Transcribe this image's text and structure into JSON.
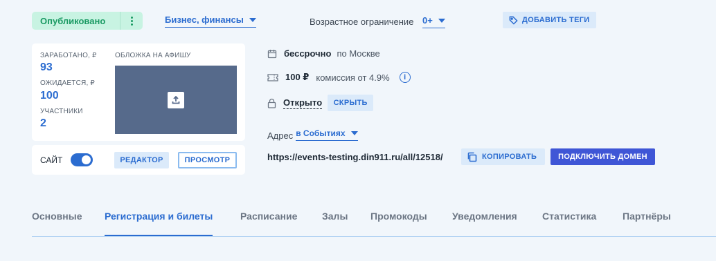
{
  "header": {
    "status_label": "Опубликовано",
    "category_label": "Бизнес, финансы",
    "age_label": "Возрастное ограничение",
    "age_value": "0+",
    "add_tags_label": "ДОБАВИТЬ ТЕГИ"
  },
  "stats": {
    "earned_label": "ЗАРАБОТАНО, ₽",
    "earned_value": "93",
    "expected_label": "ОЖИДАЕТСЯ, ₽",
    "expected_value": "100",
    "participants_label": "УЧАСТНИКИ",
    "participants_value": "2"
  },
  "cover": {
    "label": "ОБЛОЖКА НА АФИШУ",
    "upload_icon": "upload-icon"
  },
  "site": {
    "label": "САЙТ",
    "enabled": true,
    "editor_label": "РЕДАКТОР",
    "preview_label": "ПРОСМОТР"
  },
  "event_info": {
    "date_value": "бессрочно",
    "timezone": "по Москве",
    "price": "100 ₽",
    "commission": "комиссия от 4.9%",
    "info_icon": "i",
    "access_value": "Открыто",
    "hide_label": "СКРЫТЬ",
    "address_label": "Адрес",
    "address_value": "в Событиях",
    "url": "https://events-testing.din911.ru/all/12518/",
    "copy_label": "КОПИРОВАТЬ",
    "connect_domain_label": "ПОДКЛЮЧИТЬ ДОМЕН"
  },
  "tabs": [
    {
      "label": "Основные",
      "active": false
    },
    {
      "label": "Регистрация и билеты",
      "active": true
    },
    {
      "label": "Расписание",
      "active": false
    },
    {
      "label": "Залы",
      "active": false
    },
    {
      "label": "Промокоды",
      "active": false
    },
    {
      "label": "Уведомления",
      "active": false
    },
    {
      "label": "Статистика",
      "active": false
    },
    {
      "label": "Партнёры",
      "active": false
    }
  ],
  "colors": {
    "accent": "#2b6cd0",
    "status_green": "#1a9a63",
    "status_bg": "#c8f3e2",
    "primary_button": "#3f56d6",
    "cover_bg": "#566a8b",
    "page_bg": "#f1f6fb"
  }
}
